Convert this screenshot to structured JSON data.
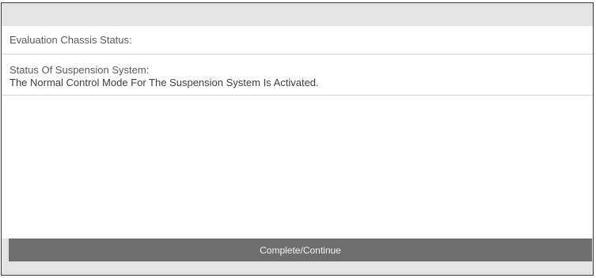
{
  "evaluation": {
    "chassis_status_label": "Evaluation Chassis Status:"
  },
  "suspension": {
    "title": "Status Of Suspension System:",
    "message": "The Normal Control Mode For The Suspension System Is Activated."
  },
  "actions": {
    "complete_continue_label": "Complete/Continue"
  },
  "colors": {
    "header_bar": "#e4e4e4",
    "button_bg": "#6e6e6e",
    "button_text": "#f2f2f2",
    "text": "#5a5a5a"
  }
}
